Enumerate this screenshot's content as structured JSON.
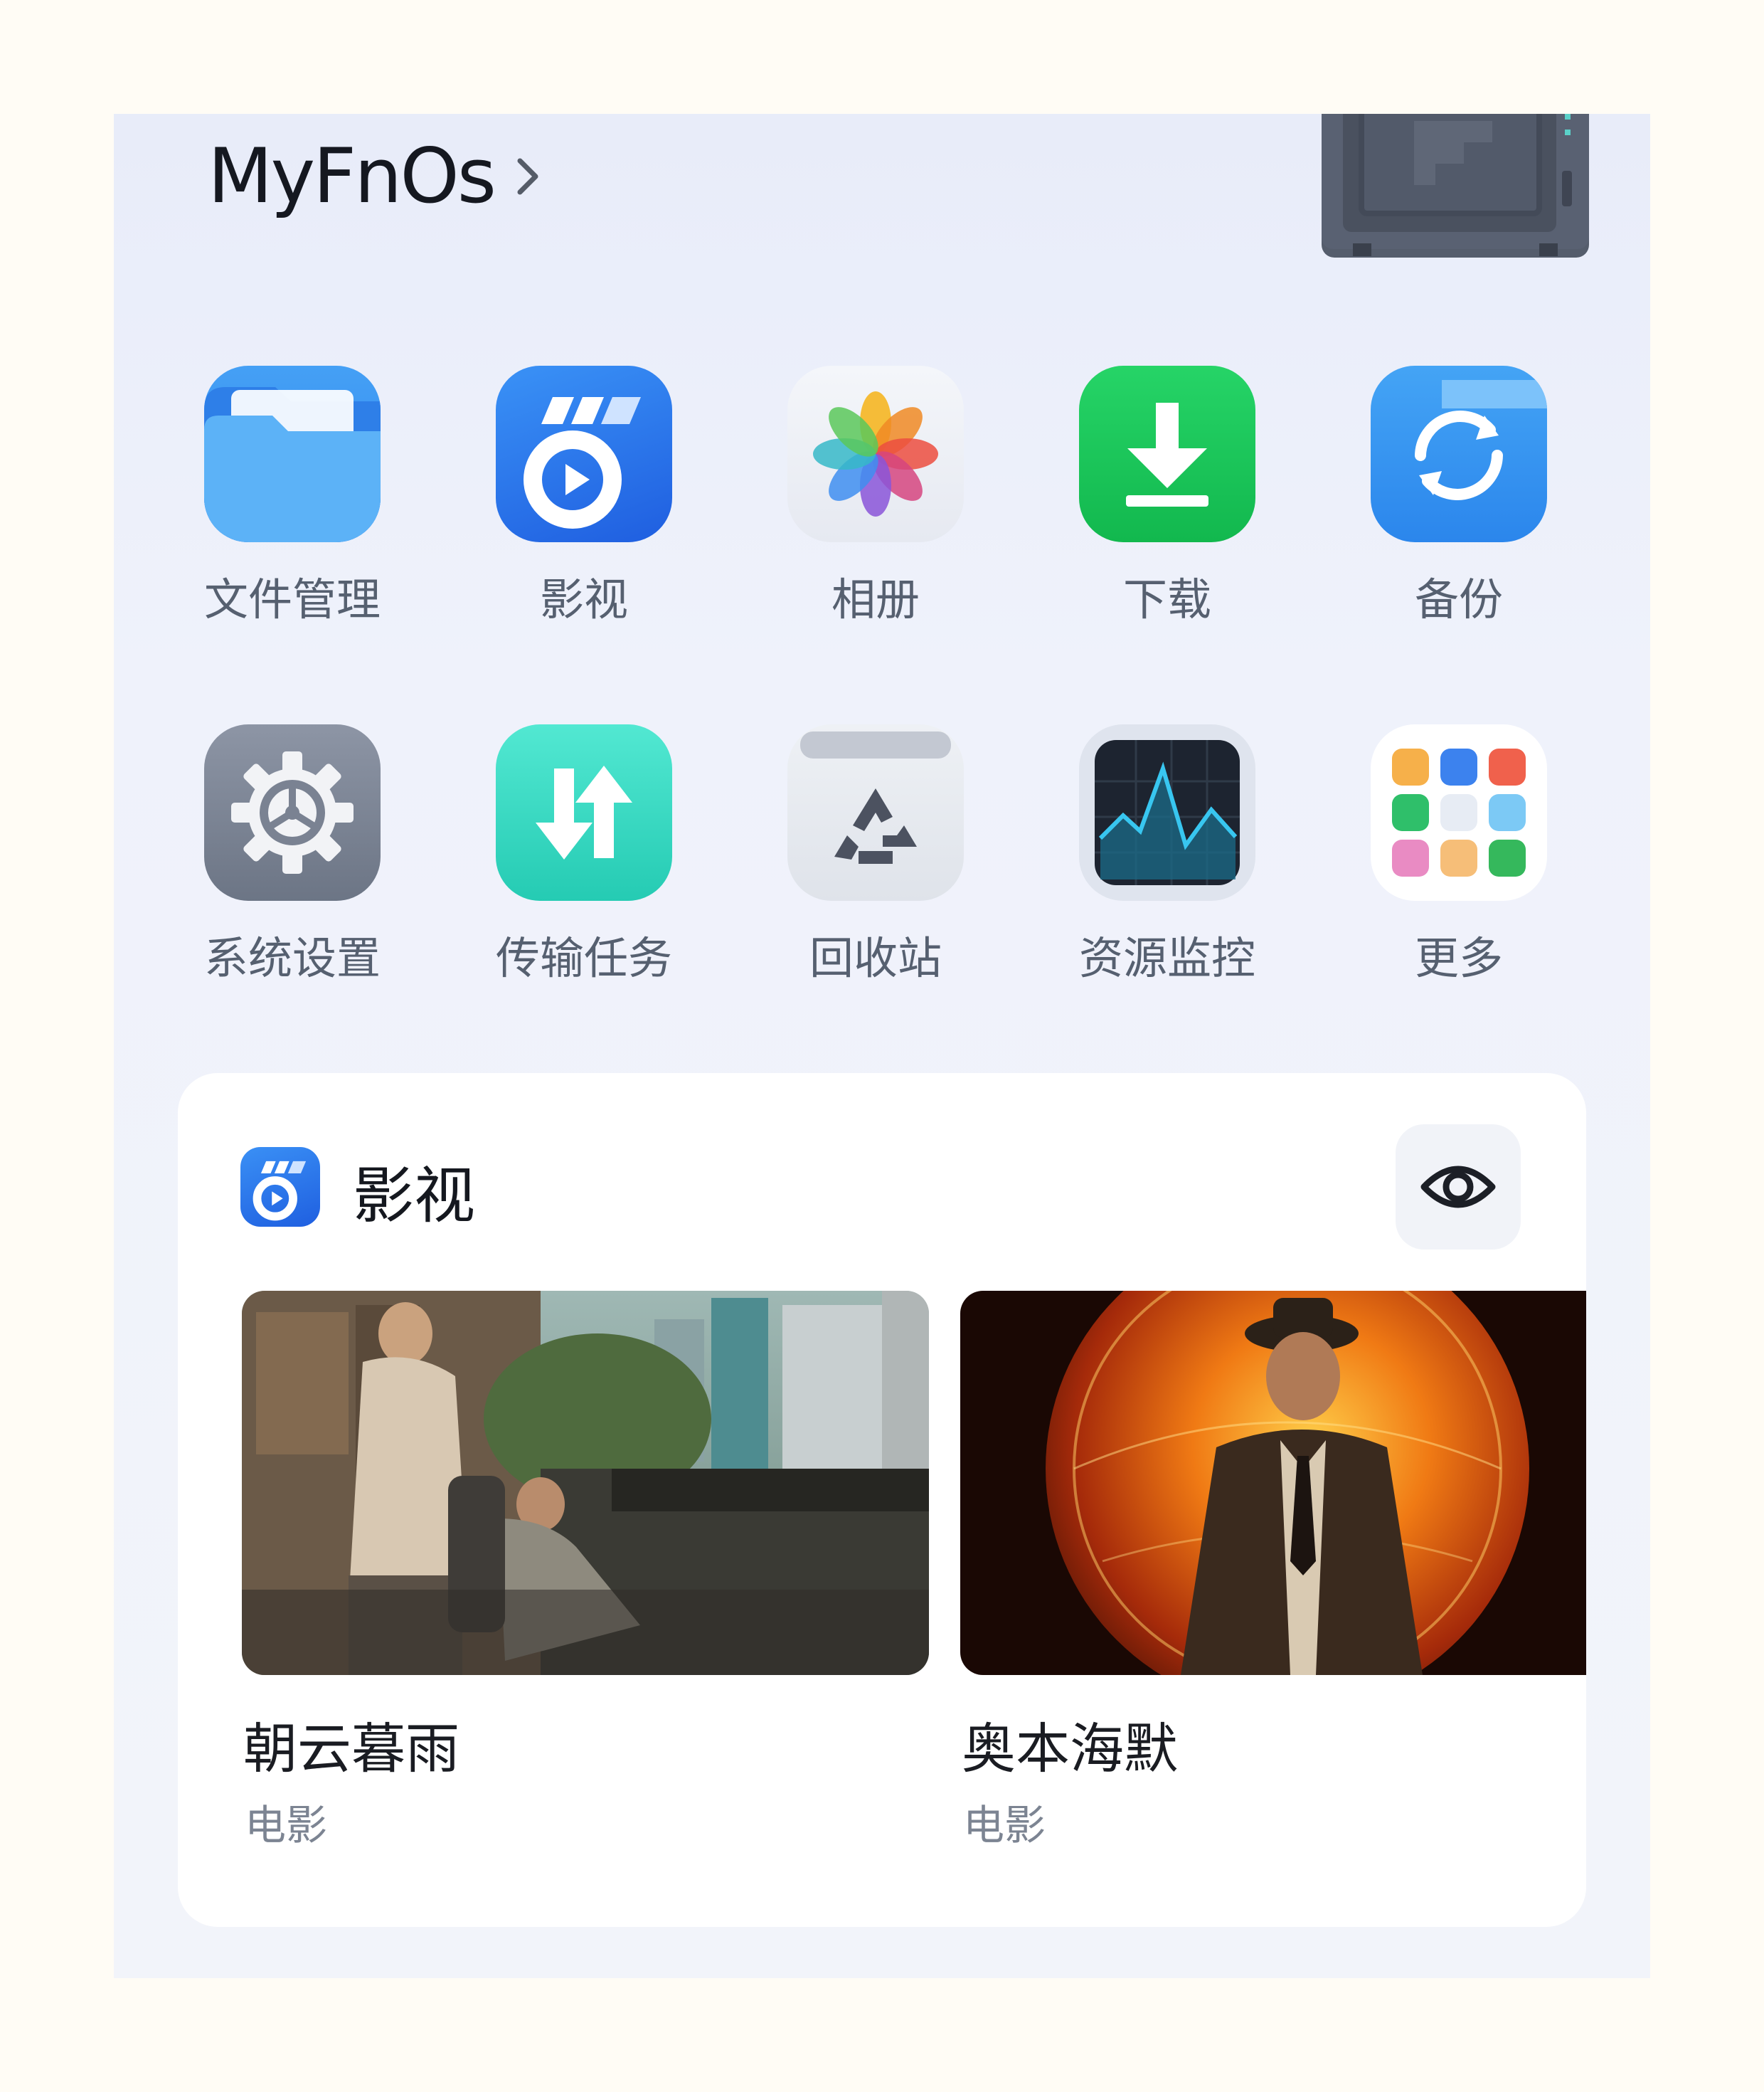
{
  "header": {
    "title": "MyFnOs"
  },
  "apps": [
    {
      "label": "文件管理",
      "icon": "folder-icon"
    },
    {
      "label": "影视",
      "icon": "video-app-icon"
    },
    {
      "label": "相册",
      "icon": "photos-pinwheel-icon"
    },
    {
      "label": "下载",
      "icon": "download-icon"
    },
    {
      "label": "备份",
      "icon": "backup-sync-icon"
    },
    {
      "label": "系统设置",
      "icon": "gear-icon"
    },
    {
      "label": "传输任务",
      "icon": "transfer-arrows-icon"
    },
    {
      "label": "回收站",
      "icon": "recycle-bin-icon"
    },
    {
      "label": "资源监控",
      "icon": "activity-monitor-icon"
    },
    {
      "label": "更多",
      "icon": "more-apps-grid-icon"
    }
  ],
  "widget": {
    "title": "影视",
    "icon": "video-app-icon",
    "toggle_icon": "eye-icon",
    "movies": [
      {
        "title": "朝云暮雨",
        "type": "电影"
      },
      {
        "title": "奥本海默",
        "type": "电影"
      }
    ]
  },
  "colors": {
    "accent_blue": "#2f7bf0",
    "download_green": "#1ec95c",
    "transfer_teal": "#2fd8c0"
  }
}
